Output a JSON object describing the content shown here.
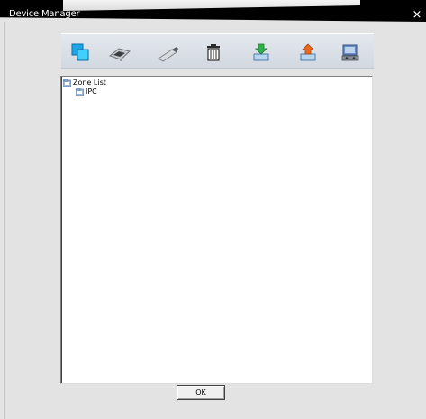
{
  "window": {
    "title": "Device Manager",
    "close_label": "×"
  },
  "toolbar": {
    "buttons": [
      {
        "name": "add-device-icon",
        "color": "#1aa6e8"
      },
      {
        "name": "network-device-icon",
        "color": "#9aa0a6"
      },
      {
        "name": "usb-device-icon",
        "color": "#b0b4b8"
      },
      {
        "name": "delete-trash-icon",
        "color": "#2b2b2b"
      },
      {
        "name": "import-icon",
        "color": "#2fb24a"
      },
      {
        "name": "export-icon",
        "color": "#e86a1c"
      },
      {
        "name": "monitor-device-icon",
        "color": "#4a6fa5"
      }
    ]
  },
  "tree": {
    "nodes": [
      {
        "label": "Zone List",
        "icon": "folder-zone-icon"
      },
      {
        "label": "IPC",
        "icon": "folder-zone-icon"
      }
    ]
  },
  "footer": {
    "ok_label": "OK"
  }
}
